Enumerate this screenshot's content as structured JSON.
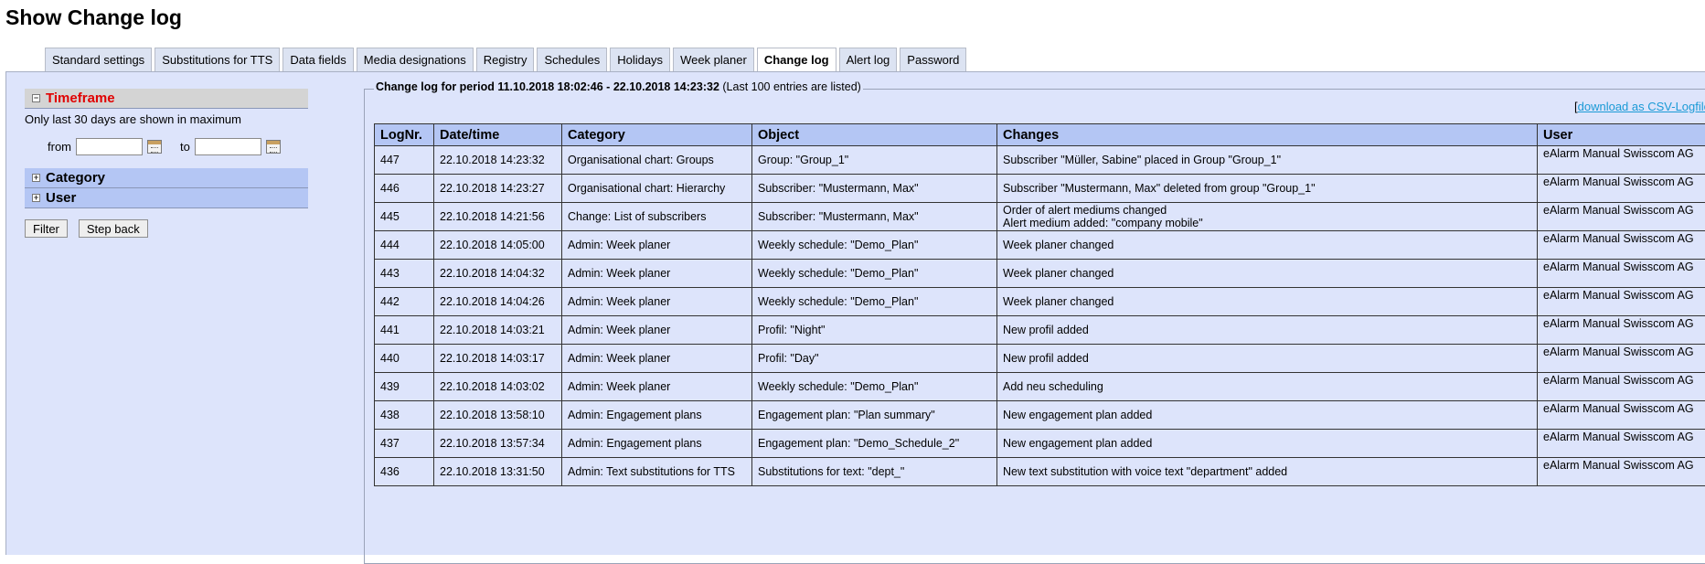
{
  "page": {
    "title": "Show Change log"
  },
  "tabs": [
    {
      "label": "Standard settings",
      "active": false
    },
    {
      "label": "Substitutions for TTS",
      "active": false
    },
    {
      "label": "Data fields",
      "active": false
    },
    {
      "label": "Media designations",
      "active": false
    },
    {
      "label": "Registry",
      "active": false
    },
    {
      "label": "Schedules",
      "active": false
    },
    {
      "label": "Holidays",
      "active": false
    },
    {
      "label": "Week planer",
      "active": false
    },
    {
      "label": "Change log",
      "active": true
    },
    {
      "label": "Alert log",
      "active": false
    },
    {
      "label": "Password",
      "active": false
    }
  ],
  "sidebar": {
    "timeframe": {
      "label": "Timeframe",
      "hint": "Only last 30 days are shown in maximum",
      "from_label": "from",
      "to_label": "to",
      "from_value": "",
      "to_value": ""
    },
    "category": {
      "label": "Category"
    },
    "user": {
      "label": "User"
    },
    "filter_label": "Filter",
    "stepback_label": "Step back"
  },
  "log": {
    "legend_prefix": "Change log for period 11.10.2018 18:02:46 - 22.10.2018 14:23:32",
    "legend_suffix": " (Last 100 entries are listed)",
    "csv_link": "download as CSV-Logfile",
    "columns": [
      "LogNr.",
      "Date/time",
      "Category",
      "Object",
      "Changes",
      "User"
    ],
    "rows": [
      {
        "nr": "447",
        "date": "22.10.2018 14:23:32",
        "category": "Organisational chart: Groups",
        "object": "Group: \"Group_1\"",
        "changes": [
          "Subscriber \"Müller, Sabine\" placed in Group \"Group_1\""
        ],
        "user": "eAlarm Manual Swisscom AG"
      },
      {
        "nr": "446",
        "date": "22.10.2018 14:23:27",
        "category": "Organisational chart: Hierarchy",
        "object": "Subscriber: \"Mustermann, Max\"",
        "changes": [
          "Subscriber \"Mustermann, Max\" deleted from group \"Group_1\""
        ],
        "user": "eAlarm Manual Swisscom AG"
      },
      {
        "nr": "445",
        "date": "22.10.2018 14:21:56",
        "category": "Change: List of subscribers",
        "object": "Subscriber: \"Mustermann, Max\"",
        "changes": [
          "Order of alert mediums changed",
          "Alert medium added: \"company mobile\""
        ],
        "user": "eAlarm Manual Swisscom AG"
      },
      {
        "nr": "444",
        "date": "22.10.2018 14:05:00",
        "category": "Admin: Week planer",
        "object": "Weekly schedule: \"Demo_Plan\"",
        "changes": [
          "Week planer changed"
        ],
        "user": "eAlarm Manual Swisscom AG"
      },
      {
        "nr": "443",
        "date": "22.10.2018 14:04:32",
        "category": "Admin: Week planer",
        "object": "Weekly schedule: \"Demo_Plan\"",
        "changes": [
          "Week planer changed"
        ],
        "user": "eAlarm Manual Swisscom AG"
      },
      {
        "nr": "442",
        "date": "22.10.2018 14:04:26",
        "category": "Admin: Week planer",
        "object": "Weekly schedule: \"Demo_Plan\"",
        "changes": [
          "Week planer changed"
        ],
        "user": "eAlarm Manual Swisscom AG"
      },
      {
        "nr": "441",
        "date": "22.10.2018 14:03:21",
        "category": "Admin: Week planer",
        "object": "Profil: \"Night\"",
        "changes": [
          "New profil added"
        ],
        "user": "eAlarm Manual Swisscom AG"
      },
      {
        "nr": "440",
        "date": "22.10.2018 14:03:17",
        "category": "Admin: Week planer",
        "object": "Profil: \"Day\"",
        "changes": [
          "New profil added"
        ],
        "user": "eAlarm Manual Swisscom AG"
      },
      {
        "nr": "439",
        "date": "22.10.2018 14:03:02",
        "category": "Admin: Week planer",
        "object": "Weekly schedule: \"Demo_Plan\"",
        "changes": [
          "Add neu scheduling"
        ],
        "user": "eAlarm Manual Swisscom AG"
      },
      {
        "nr": "438",
        "date": "22.10.2018 13:58:10",
        "category": "Admin: Engagement plans",
        "object": "Engagement plan: \"Plan summary\"",
        "changes": [
          "New engagement plan added"
        ],
        "user": "eAlarm Manual Swisscom AG"
      },
      {
        "nr": "437",
        "date": "22.10.2018 13:57:34",
        "category": "Admin: Engagement plans",
        "object": "Engagement plan: \"Demo_Schedule_2\"",
        "changes": [
          "New engagement plan added"
        ],
        "user": "eAlarm Manual Swisscom AG"
      },
      {
        "nr": "436",
        "date": "22.10.2018 13:31:50",
        "category": "Admin: Text substitutions for TTS",
        "object": "Substitutions for text: \"dept_\"",
        "changes": [
          "New text substitution with voice text \"department\" added"
        ],
        "user": "eAlarm Manual Swisscom AG"
      }
    ]
  }
}
